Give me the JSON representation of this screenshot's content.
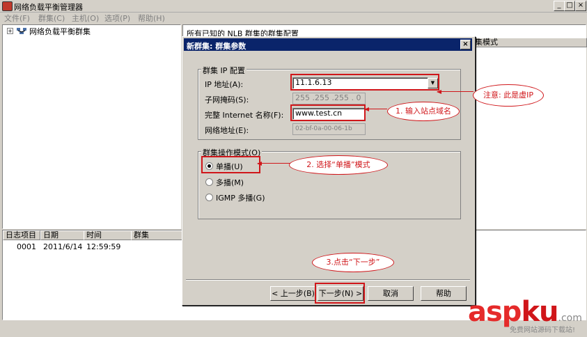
{
  "window": {
    "title": "网络负载平衡管理器",
    "min_glyph": "_",
    "max_glyph": "□",
    "close_glyph": "×"
  },
  "menu": [
    "文件(F)",
    "群集(C)",
    "主机(O)",
    "选项(P)",
    "帮助(H)"
  ],
  "tree": {
    "expander": "+",
    "root_label": "网络负载平衡群集"
  },
  "right_pane": {
    "header": "所有已知的 NLB 群集的群集配置",
    "column": "集模式"
  },
  "log": {
    "columns": [
      "日志项目",
      "日期",
      "时间",
      "群集"
    ],
    "rows": [
      {
        "item": "0001",
        "date": "2011/6/14",
        "time": "12:59:59",
        "cluster": ""
      }
    ]
  },
  "dialog": {
    "title": "新群集:  群集参数",
    "close_glyph": "×",
    "ip_group": {
      "label": "群集 IP 配置",
      "ip_label": "IP 地址(A):",
      "ip_value": "11.1.6.13",
      "subnet_label": "子网掩码(S):",
      "subnet_value": "255 .255 .255 . 0",
      "fqdn_label": "完整 Internet 名称(F):",
      "fqdn_value": "www.test.cn",
      "netaddr_label": "网络地址(E):",
      "netaddr_value": "02-bf-0a-00-06-1b"
    },
    "mode_group": {
      "label": "群集操作模式(O)",
      "options": [
        {
          "label": "单播(U)",
          "selected": true
        },
        {
          "label": "多播(M)",
          "selected": false
        },
        {
          "label": "IGMP 多播(G)",
          "selected": false
        }
      ]
    },
    "buttons": {
      "back": "< 上一步(B)",
      "next": "下一步(N) >",
      "cancel": "取消",
      "help": "帮助"
    }
  },
  "annotations": {
    "note_vip": "注意: 此是虚IP",
    "step1": "1. 输入站点域名",
    "step2": "2. 选择“单播”模式",
    "step3": "3.点击“下一步”",
    "annotation_color": "#d0161a"
  },
  "watermark": {
    "main_a": "asp",
    "main_b": "ku",
    "main_c": ".com",
    "sub": "免费网站源码下载站!"
  }
}
